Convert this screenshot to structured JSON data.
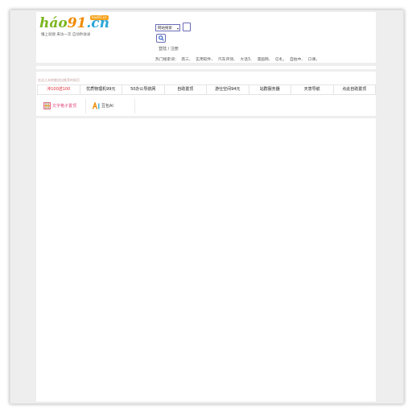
{
  "logo": {
    "hao": "háo",
    "num": "91",
    "cn": ".cn",
    "badge": "hao91.cn",
    "slogan": "懂上就搜  来访一次  自动秒收录"
  },
  "search": {
    "select_value": "网站搜索",
    "button_icon": "search-icon"
  },
  "auth": {
    "login": "登陆",
    "separator": " / ",
    "register": "注册"
  },
  "hot": {
    "label": "热门搜索词：",
    "words": [
      "高三、",
      "实用软件、",
      "汽车评测、",
      "大话3、",
      "漫画网、",
      "信札、",
      "自拍中、",
      "口课。"
    ]
  },
  "notice": "在这儿本地搬进自推荐的网页",
  "links": [
    {
      "label": "沖100送100",
      "highlight": true
    },
    {
      "label": "优质物理机99元",
      "highlight": false
    },
    {
      "label": "50办公导航网",
      "highlight": false
    },
    {
      "label": "自助置顶",
      "highlight": false
    },
    {
      "label": "游仕空间94元",
      "highlight": false
    },
    {
      "label": "站群服务器",
      "highlight": false
    },
    {
      "label": "天意导航",
      "highlight": false
    },
    {
      "label": "点此自助置顶",
      "highlight": false
    }
  ],
  "apps": [
    {
      "label": "文字格子置顶",
      "icon": "grid-icon",
      "color": "#e0457a"
    },
    {
      "label": "豆包AI",
      "icon": "ai-icon",
      "color": "#444444"
    }
  ]
}
